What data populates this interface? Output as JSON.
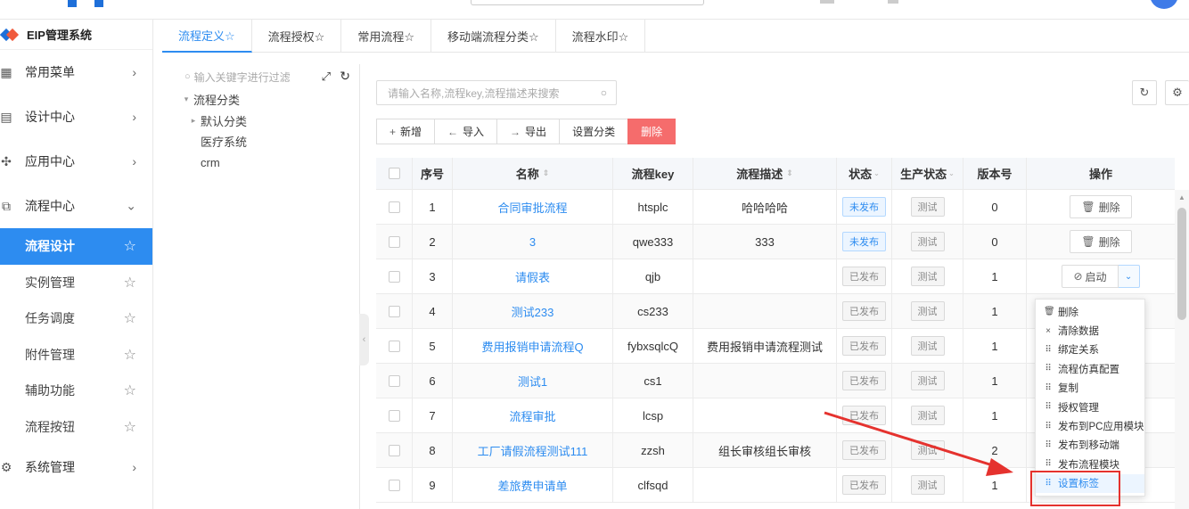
{
  "app": {
    "brand": "EIP管理系统",
    "search_placeholder": ""
  },
  "sidebar": {
    "groups": [
      {
        "label": "常用菜单",
        "icon": "grid-icon",
        "expanded": false
      },
      {
        "label": "设计中心",
        "icon": "design-icon",
        "expanded": false
      },
      {
        "label": "应用中心",
        "icon": "apps-icon",
        "expanded": false
      },
      {
        "label": "流程中心",
        "icon": "flow-icon",
        "expanded": true
      }
    ],
    "sub_items": [
      {
        "label": "流程设计",
        "active": true
      },
      {
        "label": "实例管理",
        "active": false
      },
      {
        "label": "任务调度",
        "active": false
      },
      {
        "label": "附件管理",
        "active": false
      },
      {
        "label": "辅助功能",
        "active": false
      },
      {
        "label": "流程按钮",
        "active": false
      }
    ],
    "bottom_group": {
      "label": "系统管理",
      "icon": "gear-icon",
      "expanded": false
    }
  },
  "tabs": [
    {
      "label": "流程定义☆",
      "active": true
    },
    {
      "label": "流程授权☆",
      "active": false
    },
    {
      "label": "常用流程☆",
      "active": false
    },
    {
      "label": "移动端流程分类☆",
      "active": false
    },
    {
      "label": "流程水印☆",
      "active": false
    }
  ],
  "tree": {
    "search_placeholder": "输入关键字进行过滤",
    "nodes": [
      {
        "label": "流程分类",
        "level": 0,
        "caret": "down"
      },
      {
        "label": "默认分类",
        "level": 1,
        "caret": "right"
      },
      {
        "label": "医疗系统",
        "level": 1,
        "caret": ""
      },
      {
        "label": "crm",
        "level": 1,
        "caret": ""
      }
    ]
  },
  "list": {
    "search_placeholder": "请输入名称,流程key,流程描述来搜索",
    "toolbar": {
      "add": "新增",
      "import": "导入",
      "export": "导出",
      "set_category": "设置分类",
      "delete": "删除"
    },
    "columns": {
      "no": "序号",
      "name": "名称",
      "key": "流程key",
      "desc": "流程描述",
      "state": "状态",
      "prod_state": "生产状态",
      "version": "版本号",
      "op": "操作"
    },
    "rows": [
      {
        "no": "1",
        "name": "合同审批流程",
        "key": "htsplc",
        "desc": "哈哈哈哈",
        "state": "未发布",
        "state_type": "blue",
        "prod": "测试",
        "version": "0",
        "op": "删除",
        "op_type": "delete"
      },
      {
        "no": "2",
        "name": "3",
        "key": "qwe333",
        "desc": "333",
        "state": "未发布",
        "state_type": "blue",
        "prod": "测试",
        "version": "0",
        "op": "删除",
        "op_type": "delete"
      },
      {
        "no": "3",
        "name": "请假表",
        "key": "qjb",
        "desc": "",
        "state": "已发布",
        "state_type": "gray",
        "prod": "测试",
        "version": "1",
        "op": "启动",
        "op_type": "split"
      },
      {
        "no": "4",
        "name": "测试233",
        "key": "cs233",
        "desc": "",
        "state": "已发布",
        "state_type": "gray",
        "prod": "测试",
        "version": "1",
        "op": "",
        "op_type": "none"
      },
      {
        "no": "5",
        "name": "费用报销申请流程Q",
        "key": "fybxsqlcQ",
        "desc": "费用报销申请流程测试",
        "state": "已发布",
        "state_type": "gray",
        "prod": "测试",
        "version": "1",
        "op": "",
        "op_type": "none"
      },
      {
        "no": "6",
        "name": "测试1",
        "key": "cs1",
        "desc": "",
        "state": "已发布",
        "state_type": "gray",
        "prod": "测试",
        "version": "1",
        "op": "",
        "op_type": "none"
      },
      {
        "no": "7",
        "name": "流程审批",
        "key": "lcsp",
        "desc": "",
        "state": "已发布",
        "state_type": "gray",
        "prod": "测试",
        "version": "1",
        "op": "",
        "op_type": "none"
      },
      {
        "no": "8",
        "name": "工厂请假流程测试111",
        "key": "zzsh",
        "desc": "组长审核组长审核",
        "state": "已发布",
        "state_type": "gray",
        "prod": "测试",
        "version": "2",
        "op": "",
        "op_type": "none"
      },
      {
        "no": "9",
        "name": "差旅费申请单",
        "key": "clfsqd",
        "desc": "",
        "state": "已发布",
        "state_type": "gray",
        "prod": "测试",
        "version": "1",
        "op": "",
        "op_type": "none"
      }
    ]
  },
  "dropdown": {
    "items": [
      {
        "label": "删除",
        "icon": "trash-icon",
        "highlight": false
      },
      {
        "label": "清除数据",
        "icon": "close-icon",
        "highlight": false
      },
      {
        "label": "绑定关系",
        "icon": "grid-icon",
        "highlight": false
      },
      {
        "label": "流程仿真配置",
        "icon": "grid-icon",
        "highlight": false
      },
      {
        "label": "复制",
        "icon": "grid-icon",
        "highlight": false
      },
      {
        "label": "授权管理",
        "icon": "grid-icon",
        "highlight": false
      },
      {
        "label": "发布到PC应用模块",
        "icon": "grid-icon",
        "highlight": false
      },
      {
        "label": "发布到移动端",
        "icon": "grid-icon",
        "highlight": false
      },
      {
        "label": "发布流程模块",
        "icon": "grid-icon",
        "highlight": false
      },
      {
        "label": "设置标签",
        "icon": "grid-icon",
        "highlight": true
      }
    ]
  },
  "colors": {
    "accent": "#2d8cf0",
    "danger": "#f56c6c",
    "annotation": "#e5322e"
  }
}
